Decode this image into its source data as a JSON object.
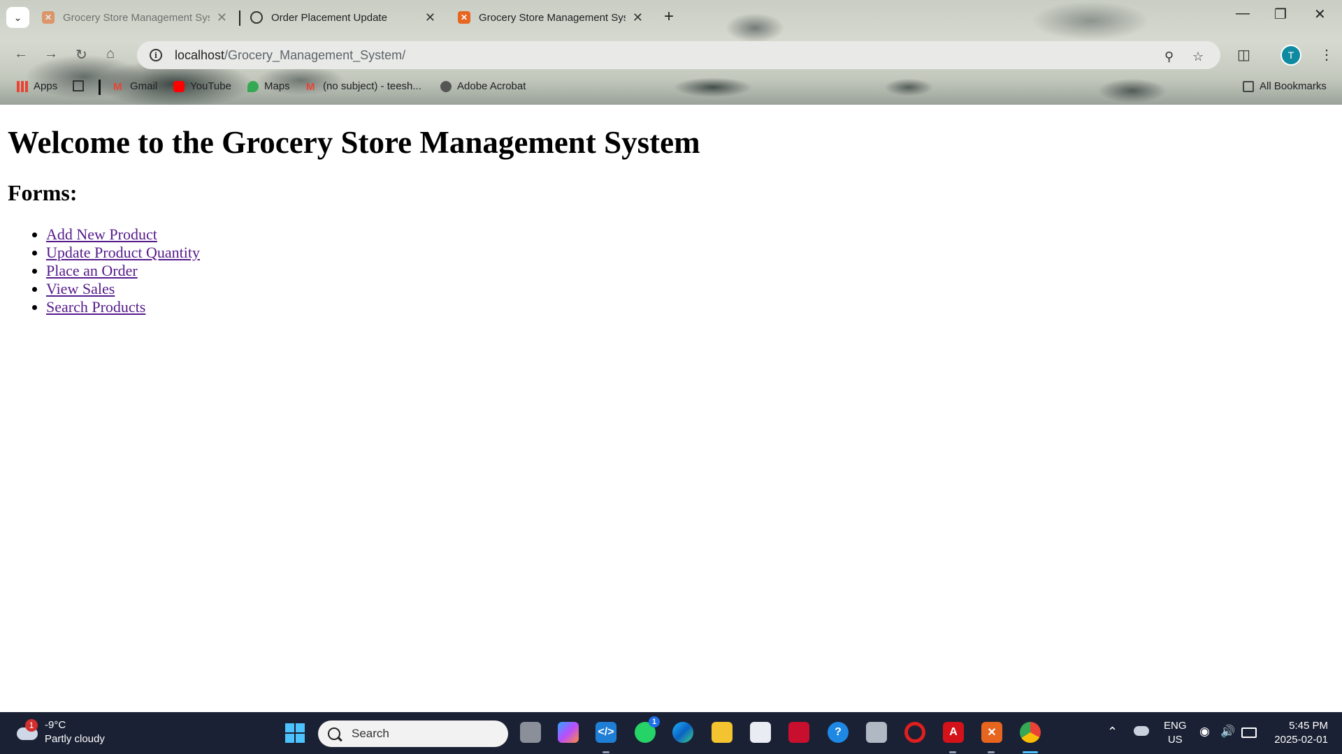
{
  "browser": {
    "tabs": [
      {
        "title": "Grocery Store Management System"
      },
      {
        "title": "Order Placement Update"
      },
      {
        "title": "Grocery Store Management System"
      }
    ],
    "tab_search_icon": "chevron-down-icon",
    "new_tab_label": "+",
    "window": {
      "minimize": "—",
      "restore": "❐",
      "close": "✕"
    },
    "address": {
      "host": "localhost",
      "path": "/Grocery_Management_System/"
    },
    "profile_initial": "T",
    "bookmarks": [
      {
        "label": "Apps"
      },
      {
        "label": "Gmail"
      },
      {
        "label": "YouTube"
      },
      {
        "label": "Maps"
      },
      {
        "label": "(no subject) - teesh..."
      },
      {
        "label": "Adobe Acrobat"
      }
    ],
    "all_bookmarks_label": "All Bookmarks"
  },
  "page": {
    "heading": "Welcome to the Grocery Store Management System",
    "subheading": "Forms:",
    "links": [
      {
        "label": "Add New Product"
      },
      {
        "label": "Update Product Quantity"
      },
      {
        "label": "Place an Order"
      },
      {
        "label": "View Sales"
      },
      {
        "label": "Search Products"
      }
    ]
  },
  "taskbar": {
    "weather": {
      "temp": "-9°C",
      "condition": "Partly cloudy",
      "badge": "1"
    },
    "search_placeholder": "Search",
    "whatsapp_badge": "1",
    "tray": {
      "lang": "ENG",
      "region": "US"
    },
    "clock": {
      "time": "5:45 PM",
      "date": "2025-02-01"
    }
  },
  "colors": {
    "link_visited": "#551a8b",
    "taskbar_bg": "#1b2134",
    "profile_bg": "#0f8aa0",
    "xampp_orange": "#e8651f"
  }
}
